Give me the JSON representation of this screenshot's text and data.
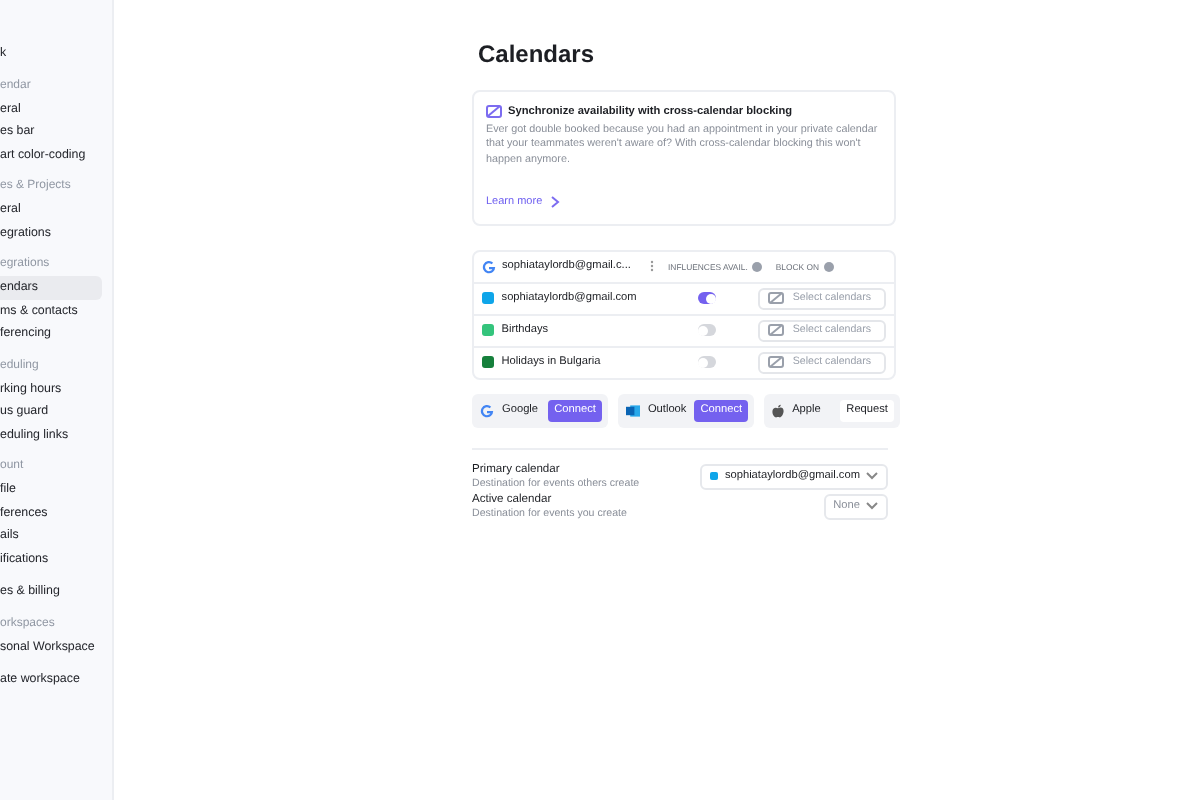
{
  "sidebar": {
    "sections": [
      {
        "items": [
          {
            "label": "k",
            "selected": false
          }
        ]
      },
      {
        "heading": "endar",
        "items": [
          {
            "label": "eral",
            "selected": false
          },
          {
            "label": "es bar",
            "selected": false
          },
          {
            "label": "art color-coding",
            "selected": false
          }
        ]
      },
      {
        "heading": "es & Projects",
        "items": [
          {
            "label": "eral",
            "selected": false
          },
          {
            "label": "egrations",
            "selected": false
          }
        ]
      },
      {
        "heading": "egrations",
        "items": [
          {
            "label": "endars",
            "selected": true
          },
          {
            "label": "ms & contacts",
            "selected": false
          },
          {
            "label": "ferencing",
            "selected": false
          }
        ]
      },
      {
        "heading": "eduling",
        "items": [
          {
            "label": "rking hours",
            "selected": false
          },
          {
            "label": "us guard",
            "selected": false
          },
          {
            "label": "eduling links",
            "selected": false
          }
        ]
      },
      {
        "heading": "ount",
        "items": [
          {
            "label": "file",
            "selected": false
          },
          {
            "label": "ferences",
            "selected": false
          },
          {
            "label": "ails",
            "selected": false
          },
          {
            "label": "ifications",
            "selected": false
          }
        ]
      },
      {
        "items": [
          {
            "label": "es & billing",
            "selected": false
          }
        ]
      },
      {
        "heading": "orkspaces",
        "items": [
          {
            "label": "sonal Workspace",
            "selected": false
          }
        ]
      },
      {
        "items": [
          {
            "label": "ate workspace",
            "selected": false
          }
        ]
      }
    ]
  },
  "title": "Calendars",
  "promo": {
    "title": "Synchronize availability with cross-calendar blocking",
    "body": "Ever got double booked because you had an appointment in your private calendar that your teammates weren't aware of? With cross-calendar blocking this won't happen anymore.",
    "link": "Learn more"
  },
  "account": {
    "email": "sophiataylordb@gmail.c...",
    "col_influences": "INFLUENCES AVAIL.",
    "col_block": "BLOCK ON",
    "calendars": [
      {
        "name": "sophiataylordb@gmail.com",
        "color": "#0ea5e9",
        "on": true,
        "select": "Select calendars"
      },
      {
        "name": "Birthdays",
        "color": "#34c47c",
        "on": false,
        "select": "Select calendars"
      },
      {
        "name": "Holidays in Bulgaria",
        "color": "#16803c",
        "on": false,
        "select": "Select calendars"
      }
    ]
  },
  "providers": [
    {
      "name": "Google",
      "kind": "google",
      "action": "Connect",
      "primary": true
    },
    {
      "name": "Outlook",
      "kind": "outlook",
      "action": "Connect",
      "primary": true
    },
    {
      "name": "Apple",
      "kind": "apple",
      "action": "Request",
      "primary": false
    }
  ],
  "settings": [
    {
      "label": "Primary calendar",
      "hint": "Destination for events others create",
      "value": "sophiataylordb@gmail.com",
      "color": "#0ea5e9"
    },
    {
      "label": "Active calendar",
      "hint": "Destination for events you create",
      "value": "None"
    }
  ]
}
